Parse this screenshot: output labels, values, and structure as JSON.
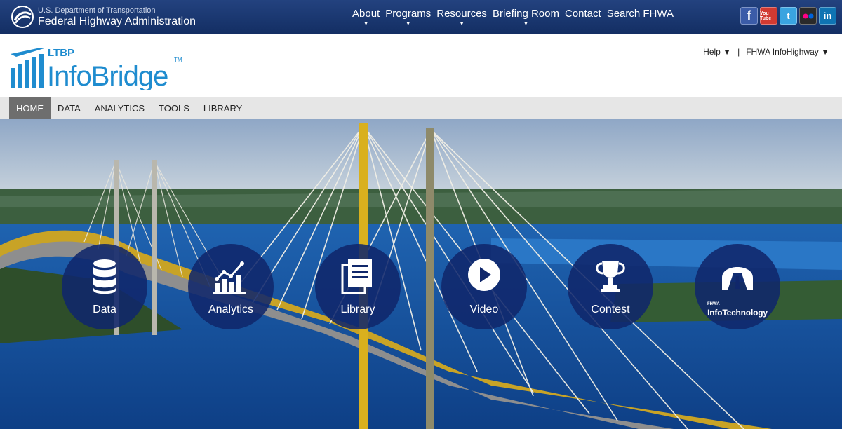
{
  "topbar": {
    "dept": "U.S. Department of Transportation",
    "agency": "Federal Highway Administration",
    "nav": [
      {
        "label": "About",
        "caret": "▼"
      },
      {
        "label": "Programs",
        "caret": "▼"
      },
      {
        "label": "Resources",
        "caret": "▼"
      },
      {
        "label": "Briefing Room",
        "caret": "▼"
      },
      {
        "label": "Contact",
        "caret": ""
      },
      {
        "label": "Search FHWA",
        "caret": ""
      }
    ],
    "social": [
      {
        "name": "facebook-icon",
        "glyph": "f"
      },
      {
        "name": "youtube-icon",
        "glyph": "You Tube"
      },
      {
        "name": "twitter-icon",
        "glyph": "t"
      },
      {
        "name": "flickr-icon",
        "glyph": "●●"
      },
      {
        "name": "linkedin-icon",
        "glyph": "in"
      }
    ]
  },
  "header": {
    "logo_small": "LTBP",
    "logo_main": "InfoBridge",
    "logo_tm": "TM",
    "help": "Help ▼",
    "separator": "|",
    "infohighway": "FHWA InfoHighway ▼"
  },
  "sitenav": [
    {
      "label": "HOME",
      "active": true
    },
    {
      "label": "DATA",
      "active": false
    },
    {
      "label": "ANALYTICS",
      "active": false
    },
    {
      "label": "TOOLS",
      "active": false
    },
    {
      "label": "LIBRARY",
      "active": false
    }
  ],
  "tiles": [
    {
      "label": "Data",
      "icon": "database-icon"
    },
    {
      "label": "Analytics",
      "icon": "bar-chart-icon"
    },
    {
      "label": "Library",
      "icon": "library-icon"
    },
    {
      "label": "Video",
      "icon": "play-icon"
    },
    {
      "label": "Contest",
      "icon": "trophy-icon"
    },
    {
      "label": "InfoTechnology",
      "small": "FHWA",
      "icon": "road-icon"
    }
  ],
  "colors": {
    "topbar": "#1a3872",
    "brand_blue": "#1f8ccf",
    "tile": "#10276b",
    "active_tab": "#6e6e6e"
  }
}
